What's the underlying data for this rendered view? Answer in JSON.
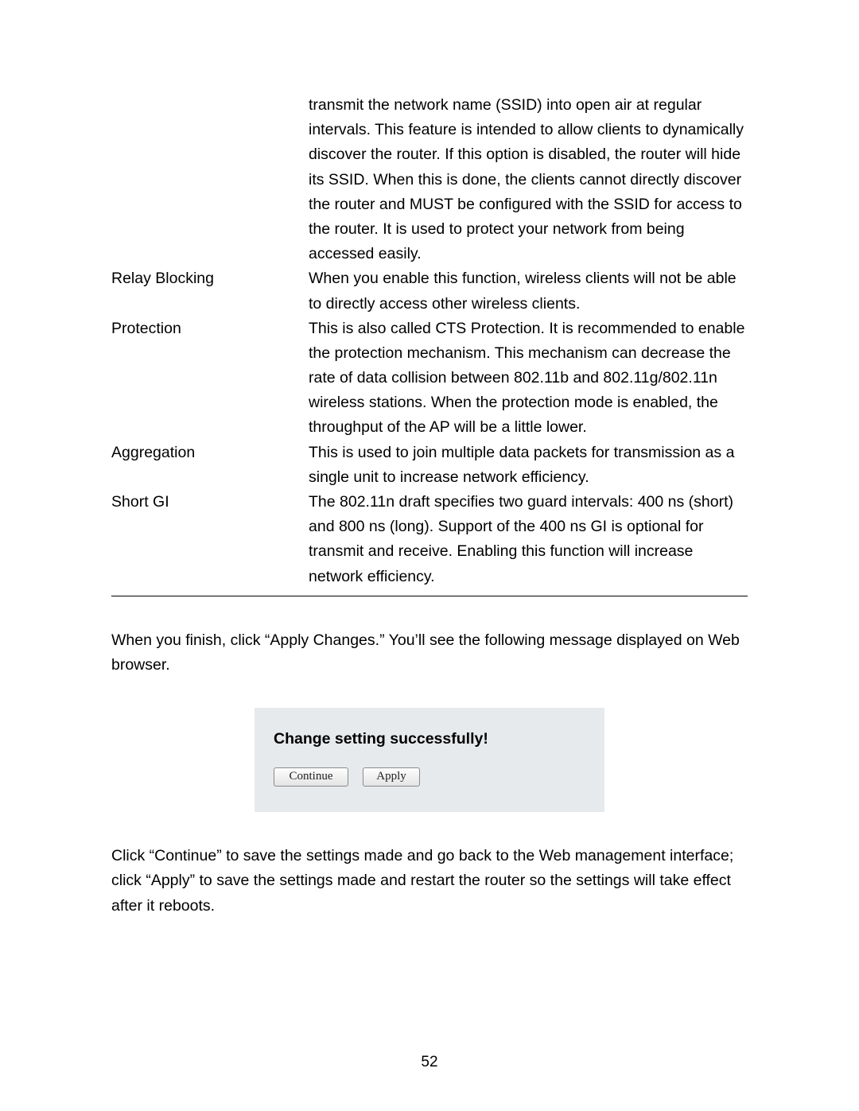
{
  "rows": [
    {
      "term": "",
      "desc": "transmit the network name (SSID) into open air at regular intervals. This feature is intended to allow clients to dynamically discover the router. If this option is disabled, the router will hide its SSID. When this is done, the clients cannot directly discover the router and MUST be configured with the SSID for access to the router. It is used to protect your network from being accessed easily."
    },
    {
      "term": "Relay Blocking",
      "desc": "When you enable this function, wireless clients will not be able to directly access other wireless clients."
    },
    {
      "term": "Protection",
      "desc": "This is also called CTS Protection. It is recommended to enable the protection mechanism. This mechanism can decrease the rate of data collision between 802.11b and 802.11g/802.11n wireless stations. When the protection mode is enabled, the throughput of the AP will be a little lower."
    },
    {
      "term": "Aggregation",
      "desc": "This is used to join multiple data packets for transmission as a single unit to increase network efficiency."
    },
    {
      "term": "Short GI",
      "desc": "The 802.11n draft specifies two guard intervals: 400 ns (short) and 800 ns (long).  Support of the 400 ns GI is optional for transmit and receive. Enabling this function will increase network efficiency."
    }
  ],
  "paragraph1": "When you finish, click “Apply Changes.” You’ll see the following message displayed on Web browser.",
  "dialog": {
    "title": "Change setting successfully!",
    "continue_label": "Continue",
    "apply_label": "Apply"
  },
  "paragraph2": "Click “Continue” to save the settings made and go back to the Web management interface; click “Apply” to save the settings made and restart the router so the settings will take effect after it reboots.",
  "page_number": "52"
}
